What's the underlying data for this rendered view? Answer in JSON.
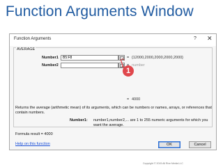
{
  "slide": {
    "title": "Function Arguments Window",
    "copyright": "Copyright © 2015 All Rive Media LLC"
  },
  "dialog": {
    "title": "Function Arguments",
    "help_symbol": "?",
    "close_symbol": "✕",
    "function_name": "AVERAGE",
    "args": [
      {
        "label": "Number1",
        "value": "B5:F8",
        "equals": "=",
        "evaluated": "{12000,2000,2000,2000,2000}"
      },
      {
        "label": "Number2",
        "value": "",
        "equals": "=",
        "evaluated": "number"
      }
    ],
    "result_equals": "=",
    "result_value": "4000",
    "description": "Returns the average (arithmetic mean) of its arguments, which can be numbers or names, arrays, or references that contain numbers.",
    "arg_description_label": "Number1:",
    "arg_description": "number1,number2,... are 1 to 255 numeric arguments for which you want the average.",
    "formula_result": "Formula result =  4000",
    "help_link": "Help on this function",
    "ok_label": "OK",
    "cancel_label": "Cancel"
  },
  "callout": {
    "number": "1",
    "color": "#e0474c"
  },
  "colors": {
    "title": "#1f5aa0",
    "link": "#1a4fd8",
    "ok_border": "#2b6fd6"
  }
}
